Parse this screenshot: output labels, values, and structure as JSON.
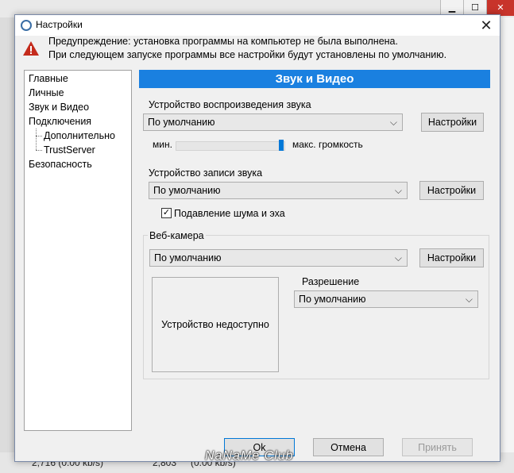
{
  "background": {
    "status_left": "2,716 (0.00 kb/s)",
    "status_right": "2,803",
    "status_right2": "(0.00 kb/s)",
    "watermark": "NaNaMe Club"
  },
  "dialog": {
    "title": "Настройки",
    "close_glyph": "✕",
    "warning_line1": "Предупреждение: установка программы на компьютер не была выполнена.",
    "warning_line2": "При следующем запуске программы все настройки будут установлены по умолчанию."
  },
  "nav": {
    "items": [
      {
        "label": "Главные"
      },
      {
        "label": "Личные"
      },
      {
        "label": "Звук и Видео"
      },
      {
        "label": "Подключения"
      },
      {
        "label": "Дополнительно"
      },
      {
        "label": "TrustServer"
      },
      {
        "label": "Безопасность"
      }
    ],
    "selected": "Звук и Видео"
  },
  "section": {
    "title": "Звук и Видео",
    "playback_label": "Устройство воспроизведения звука",
    "playback_value": "По умолчанию",
    "playback_settings": "Настройки",
    "volume_min": "мин.",
    "volume_max": "макс. громкость",
    "volume_level": 1.0,
    "record_label": "Устройство записи звука",
    "record_value": "По умолчанию",
    "record_settings": "Настройки",
    "noise_label": "Подавление шума и эха",
    "noise_checked": true,
    "webcam_label": "Веб-камера",
    "webcam_value": "По умолчанию",
    "webcam_settings": "Настройки",
    "camera_unavailable": "Устройство недоступно",
    "resolution_label": "Разрешение",
    "resolution_value": "По умолчанию"
  },
  "footer": {
    "ok": "Ok",
    "cancel": "Отмена",
    "apply": "Принять"
  },
  "colors": {
    "accent": "#1a80e0",
    "slider_thumb": "#0078d7",
    "warning": "#c42b1c"
  }
}
